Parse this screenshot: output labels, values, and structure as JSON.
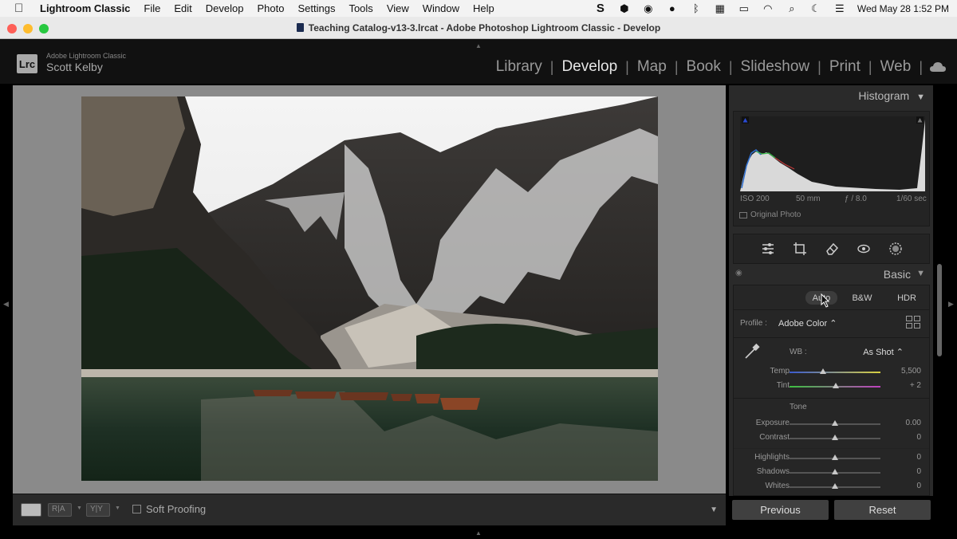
{
  "menubar": {
    "app": "Lightroom Classic",
    "items": [
      "File",
      "Edit",
      "Develop",
      "Photo",
      "Settings",
      "Tools",
      "View",
      "Window",
      "Help"
    ],
    "datetime": "Wed May 28  1:52 PM"
  },
  "window": {
    "title": "Teaching Catalog-v13-3.lrcat - Adobe Photoshop Lightroom Classic - Develop"
  },
  "header": {
    "logo": "Lrc",
    "brand": "Adobe Lightroom Classic",
    "user": "Scott Kelby",
    "modules": [
      "Library",
      "Develop",
      "Map",
      "Book",
      "Slideshow",
      "Print",
      "Web"
    ],
    "active_module": "Develop"
  },
  "toolbar": {
    "soft_proofing_label": "Soft Proofing",
    "soft_proofing_checked": false
  },
  "histogram": {
    "title": "Histogram",
    "iso": "ISO 200",
    "focal": "50 mm",
    "aperture": "ƒ / 8.0",
    "shutter": "1/60 sec",
    "original_photo_label": "Original Photo"
  },
  "basic": {
    "title": "Basic",
    "treatments": [
      "Auto",
      "B&W",
      "HDR"
    ],
    "profile_label": "Profile :",
    "profile_value": "Adobe Color ⌃",
    "wb_label": "WB :",
    "wb_value": "As Shot ⌃",
    "tone_label": "Tone",
    "sliders": [
      {
        "label": "Temp",
        "value": "5,500",
        "position": 0.37
      },
      {
        "label": "Tint",
        "value": "+ 2",
        "position": 0.51
      },
      {
        "label": "Exposure",
        "value": "0.00",
        "position": 0.5
      },
      {
        "label": "Contrast",
        "value": "0",
        "position": 0.5
      },
      {
        "label": "Highlights",
        "value": "0",
        "position": 0.5
      },
      {
        "label": "Shadows",
        "value": "0",
        "position": 0.5
      },
      {
        "label": "Whites",
        "value": "0",
        "position": 0.5
      }
    ]
  },
  "footer": {
    "previous_label": "Previous",
    "reset_label": "Reset"
  },
  "colors": {
    "panel_bg": "#2a2a2a",
    "canvas_bg": "#8a8a8a",
    "active_module": "#e6e6e6"
  }
}
